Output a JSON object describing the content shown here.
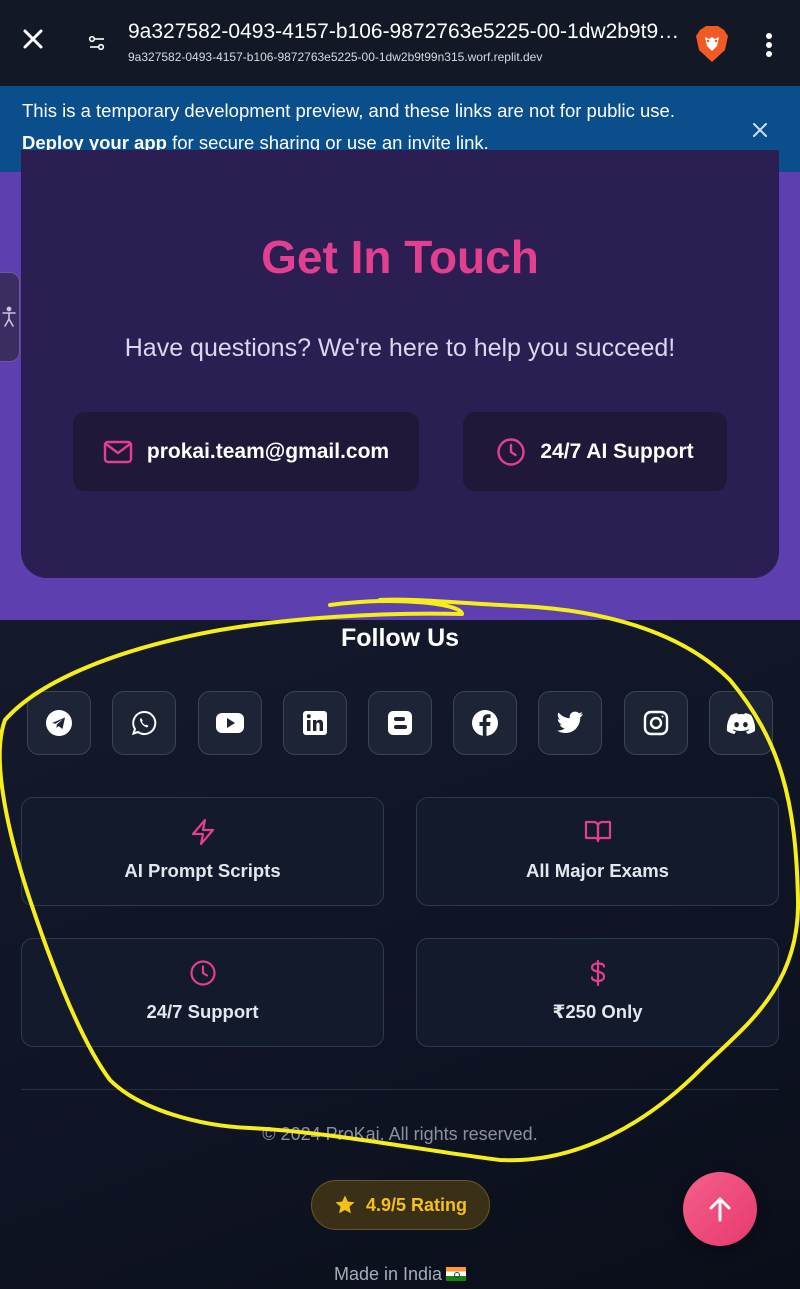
{
  "browser": {
    "title": "9a327582-0493-4157-b106-9872763e5225-00-1dw2b9t99n315.worf.replit.dev",
    "url": "9a327582-0493-4157-b106-9872763e5225-00-1dw2b9t99n315.worf.replit.dev",
    "icons": [
      "close-icon",
      "tune-icon",
      "brave-lion-icon",
      "kebab-menu-icon"
    ]
  },
  "banner": {
    "line1": "This is a temporary development preview, and these links are not for public use.",
    "link": "Deploy your app",
    "line2_rest": " for secure sharing or use an invite link.",
    "bg_color": "#0a4f8c"
  },
  "contact": {
    "title": "Get In Touch",
    "subtitle": "Have questions? We're here to help you succeed!",
    "email": "prokai.team@gmail.com",
    "support": "24/7 AI Support",
    "title_color": "#e23f91",
    "section_color": "#5e3fb0"
  },
  "footer": {
    "follow_title": "Follow Us",
    "socials": [
      "telegram",
      "whatsapp",
      "youtube",
      "linkedin",
      "blogger",
      "facebook",
      "twitter",
      "instagram",
      "discord"
    ],
    "features": [
      {
        "label": "AI Prompt Scripts",
        "icon": "bolt-icon"
      },
      {
        "label": "All Major Exams",
        "icon": "book-icon"
      },
      {
        "label": "24/7 Support",
        "icon": "clock-icon"
      },
      {
        "label": "₹250 Only",
        "icon": "dollar-icon"
      }
    ],
    "copyright": "© 2024 ProKai. All rights reserved.",
    "rating": "4.9/5 Rating",
    "made_in": "Made in India",
    "accent_color": "#e23f91"
  }
}
